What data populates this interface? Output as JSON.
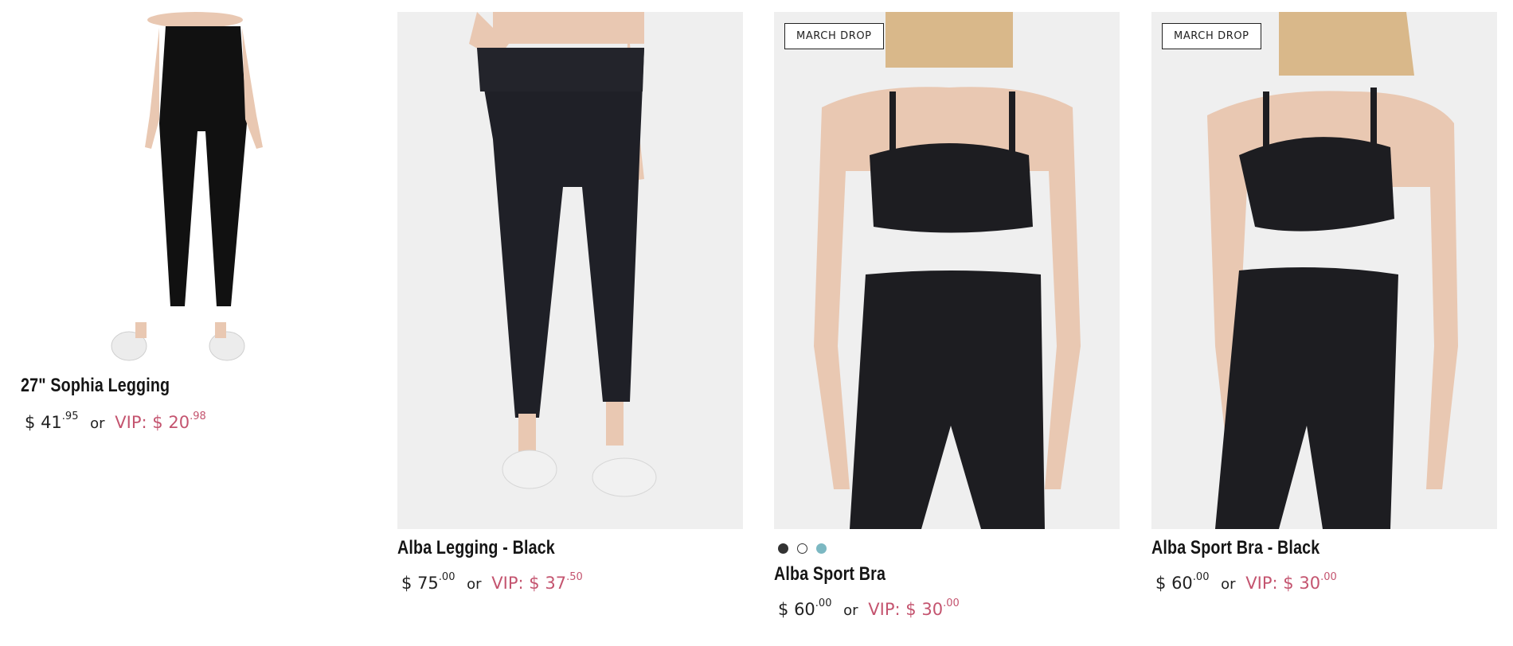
{
  "products": [
    {
      "name": "27\" Sophia Legging",
      "price_main": "41",
      "price_cents": ".95",
      "or": "or",
      "vip_label": "VIP:",
      "vip_main": "20",
      "vip_cents": ".98",
      "badge": ""
    },
    {
      "name": "Alba Legging - Black",
      "price_main": "75",
      "price_cents": ".00",
      "or": "or",
      "vip_label": "VIP:",
      "vip_main": "37",
      "vip_cents": ".50",
      "badge": ""
    },
    {
      "name": "Alba Sport Bra",
      "price_main": "60",
      "price_cents": ".00",
      "or": "or",
      "vip_label": "VIP:",
      "vip_main": "30",
      "vip_cents": ".00",
      "badge": "MARCH DROP",
      "swatches": [
        {
          "name": "black",
          "color": "#333333"
        },
        {
          "name": "white",
          "color": "#ffffff"
        },
        {
          "name": "blue",
          "color": "#7cb8c2"
        }
      ]
    },
    {
      "name": "Alba Sport Bra - Black",
      "price_main": "60",
      "price_cents": ".00",
      "or": "or",
      "vip_label": "VIP:",
      "vip_main": "30",
      "vip_cents": ".00",
      "badge": "MARCH DROP"
    }
  ],
  "currency": "$",
  "colors": {
    "vip": "#c4546f",
    "image_bg": "#efefef"
  }
}
